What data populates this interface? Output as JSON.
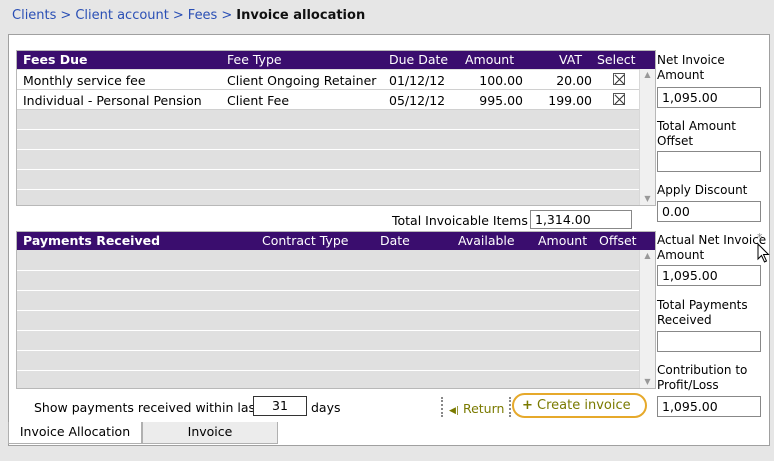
{
  "breadcrumb": {
    "items": [
      "Clients",
      "Client account",
      "Fees"
    ],
    "separator": ">",
    "current": "Invoice allocation"
  },
  "fees_due": {
    "columns": {
      "title": "Fees Due",
      "fee_type": "Fee Type",
      "due_date": "Due Date",
      "amount": "Amount",
      "vat": "VAT",
      "select": "Select"
    },
    "rows": [
      {
        "name": "Monthly service fee",
        "fee_type": "Client Ongoing Retainer",
        "due_date": "01/12/12",
        "amount": "100.00",
        "vat": "20.00",
        "selected": true
      },
      {
        "name": "Individual - Personal Pension",
        "fee_type": "Client Fee",
        "due_date": "05/12/12",
        "amount": "995.00",
        "vat": "199.00",
        "selected": true
      }
    ]
  },
  "total_invoicable": {
    "label": "Total Invoicable Items",
    "value": "1,314.00"
  },
  "payments_received": {
    "columns": {
      "title": "Payments Received",
      "contract_type": "Contract Type",
      "date": "Date",
      "available": "Available",
      "amount": "Amount",
      "offset": "Offset"
    }
  },
  "filter": {
    "label": "Show payments received within last",
    "value": "31",
    "unit": "days"
  },
  "actions": {
    "return_label": "Return",
    "create_label": "Create invoice"
  },
  "summary": {
    "net_invoice_amount": {
      "label": "Net Invoice Amount",
      "value": "1,095.00"
    },
    "total_amount_offset": {
      "label": "Total Amount Offset",
      "value": ""
    },
    "apply_discount": {
      "label": "Apply Discount",
      "value": "0.00"
    },
    "actual_net_invoice_amount": {
      "label": "Actual Net Invoice Amount",
      "value": "1,095.00",
      "marker": "*"
    },
    "total_payments_received": {
      "label": "Total Payments Received",
      "value": ""
    },
    "contribution": {
      "label": "Contribution to Profit/Loss",
      "value": "1,095.00"
    }
  },
  "tabs": [
    {
      "label": "Invoice Allocation",
      "active": true
    },
    {
      "label": "Invoice",
      "active": false
    }
  ],
  "colors": {
    "header_bg": "#3a0d6e",
    "link": "#2a4fb5",
    "highlight_ring": "#e6a92b",
    "action_text": "#7a7a00"
  }
}
